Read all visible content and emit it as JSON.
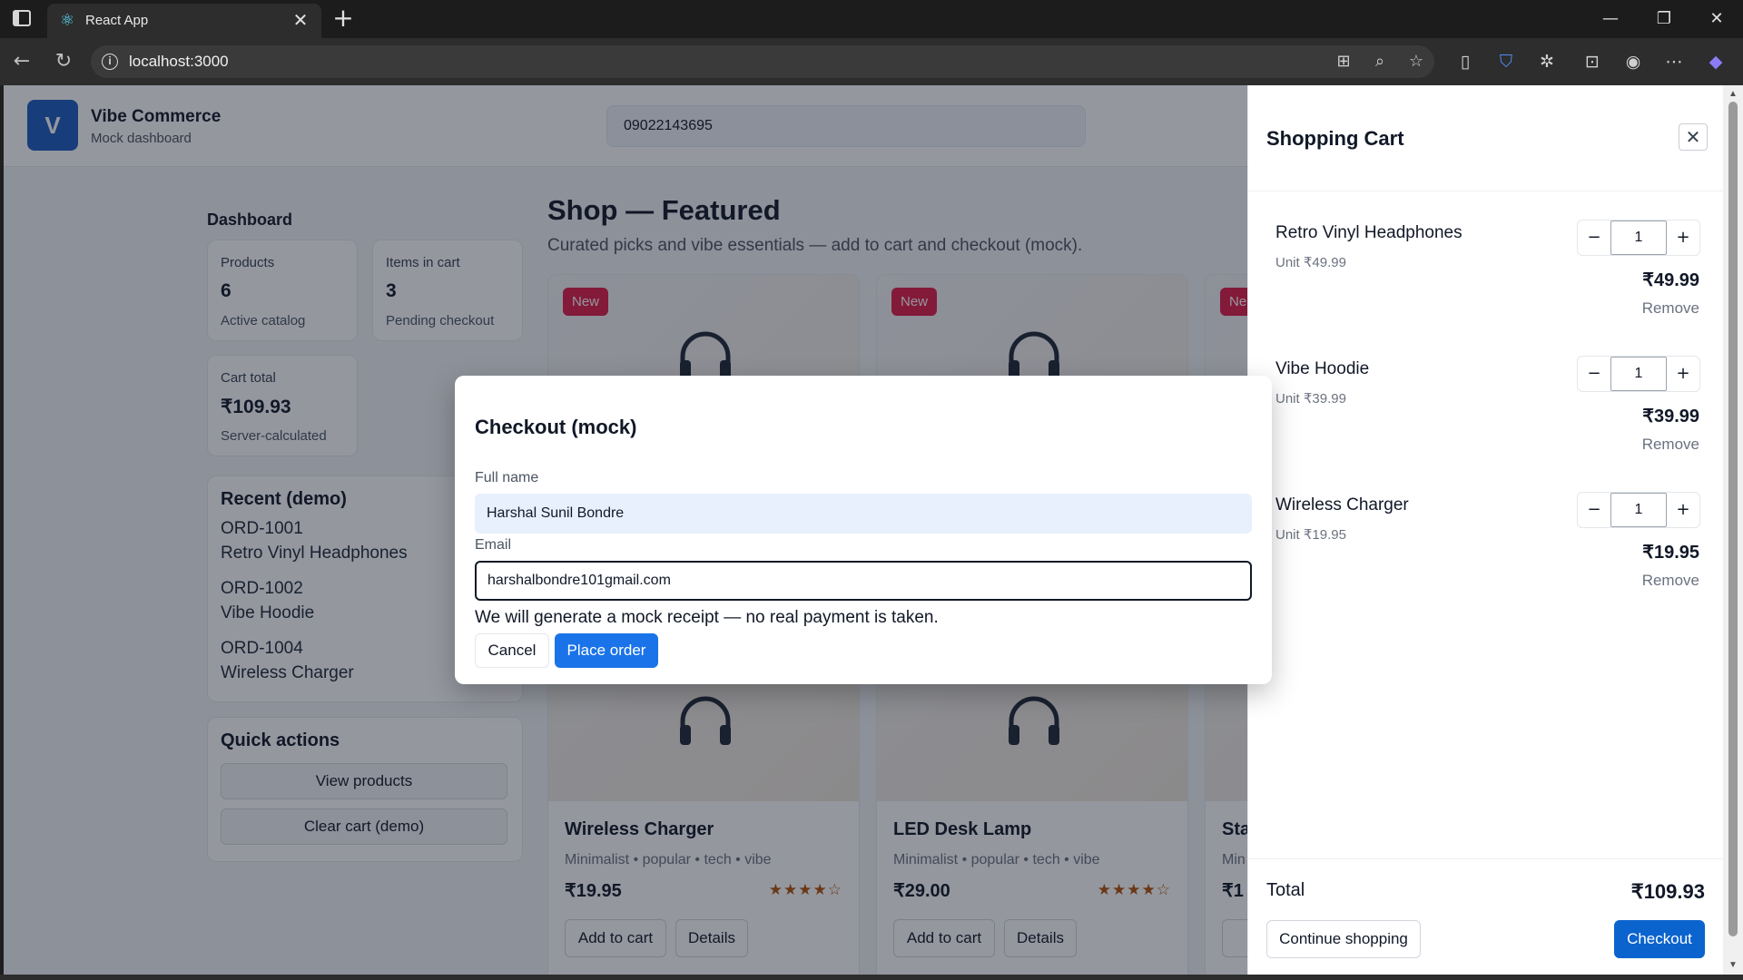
{
  "browser": {
    "tab_title": "React App",
    "tab_close": "✕",
    "new_tab": "+",
    "url": "localhost:3000",
    "win_min": "—",
    "win_restore": "❐",
    "win_close": "✕"
  },
  "header": {
    "logo_letter": "V",
    "brand_name": "Vibe Commerce",
    "brand_sub": "Mock dashboard",
    "phone": "09022143695"
  },
  "dashboard": {
    "title": "Dashboard",
    "stats": [
      {
        "label": "Products",
        "value": "6",
        "sub": "Active catalog"
      },
      {
        "label": "Items in cart",
        "value": "3",
        "sub": "Pending checkout"
      },
      {
        "label": "Cart total",
        "value": "₹109.93",
        "sub": "Server-calculated"
      }
    ],
    "recent": {
      "title": "Recent (demo)",
      "items": [
        {
          "id": "ORD-1001",
          "name": "Retro Vinyl Headphones"
        },
        {
          "id": "ORD-1002",
          "name": "Vibe Hoodie"
        },
        {
          "id": "ORD-1004",
          "name": "Wireless Charger"
        }
      ]
    },
    "quick_actions": {
      "title": "Quick actions",
      "view_products": "View products",
      "clear_cart": "Clear cart (demo)"
    }
  },
  "shop": {
    "title": "Shop — Featured",
    "subtitle": "Curated picks and vibe essentials — add to cart and checkout (mock).",
    "badge_new": "New",
    "badge_partial": "Ne",
    "products": [
      {
        "name": "Wireless Charger",
        "tags": "Minimalist • popular • tech • vibe",
        "price": "₹19.95",
        "stars": "★★★★☆",
        "add": "Add to cart",
        "details": "Details"
      },
      {
        "name": "LED Desk Lamp",
        "tags": "Minimalist • popular • tech • vibe",
        "price": "₹29.00",
        "stars": "★★★★☆",
        "add": "Add to cart",
        "details": "Details"
      },
      {
        "name": "Sta",
        "tags": "Min",
        "price": "₹1",
        "add": "A"
      }
    ]
  },
  "cart": {
    "title": "Shopping Cart",
    "close": "✕",
    "items": [
      {
        "name": "Retro Vinyl Headphones",
        "unit": "Unit ₹49.99",
        "qty": "1",
        "price": "₹49.99",
        "remove": "Remove"
      },
      {
        "name": "Vibe Hoodie",
        "unit": "Unit ₹39.99",
        "qty": "1",
        "price": "₹39.99",
        "remove": "Remove"
      },
      {
        "name": "Wireless Charger",
        "unit": "Unit ₹19.95",
        "qty": "1",
        "price": "₹19.95",
        "remove": "Remove"
      }
    ],
    "minus": "−",
    "plus": "+",
    "total_label": "Total",
    "total_value": "₹109.93",
    "continue": "Continue shopping",
    "checkout": "Checkout"
  },
  "modal": {
    "title": "Checkout (mock)",
    "name_label": "Full name",
    "name_value": "Harshal Sunil Bondre",
    "email_label": "Email",
    "email_value": "harshalbondre101gmail.com",
    "note": "We will generate a mock receipt — no real payment is taken.",
    "cancel": "Cancel",
    "place": "Place order"
  }
}
